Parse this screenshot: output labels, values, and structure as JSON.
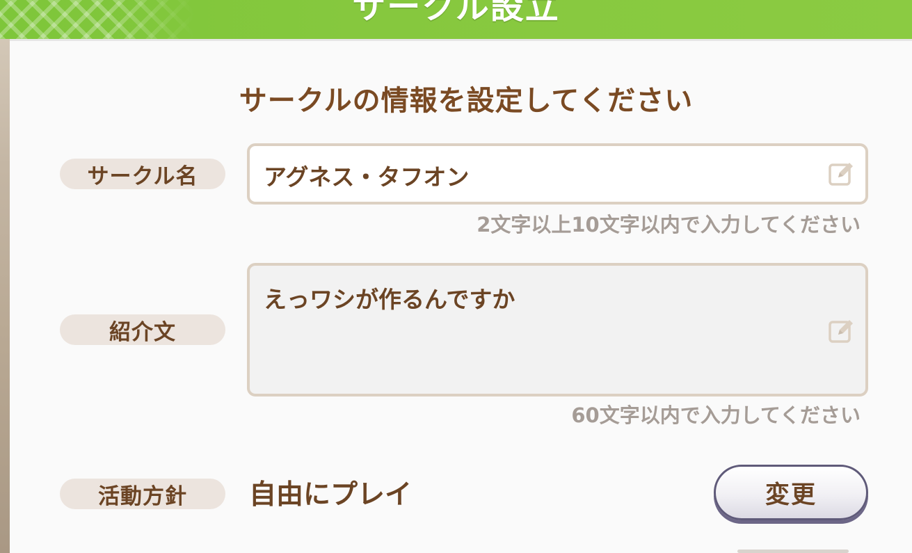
{
  "header": {
    "title": "サークル設立"
  },
  "heading": "サークルの情報を設定してください",
  "name_field": {
    "label": "サークル名",
    "value": "アグネス・タフオン",
    "hint": "2文字以上10文字以内で入力してください",
    "icon": "edit-icon"
  },
  "intro_field": {
    "label": "紹介文",
    "value": "えっワシが作るんですか",
    "hint": "60文字以内で入力してください",
    "icon": "edit-icon"
  },
  "policy": {
    "label": "活動方針",
    "value": "自由にプレイ",
    "change_label": "変更"
  },
  "colors": {
    "header_green": "#86c83e",
    "text_brown": "#6b4424",
    "label_bg": "#ece4de",
    "field_border": "#dcd0c2",
    "hint_gray": "#a59c96",
    "button_border": "#5f5a79"
  }
}
